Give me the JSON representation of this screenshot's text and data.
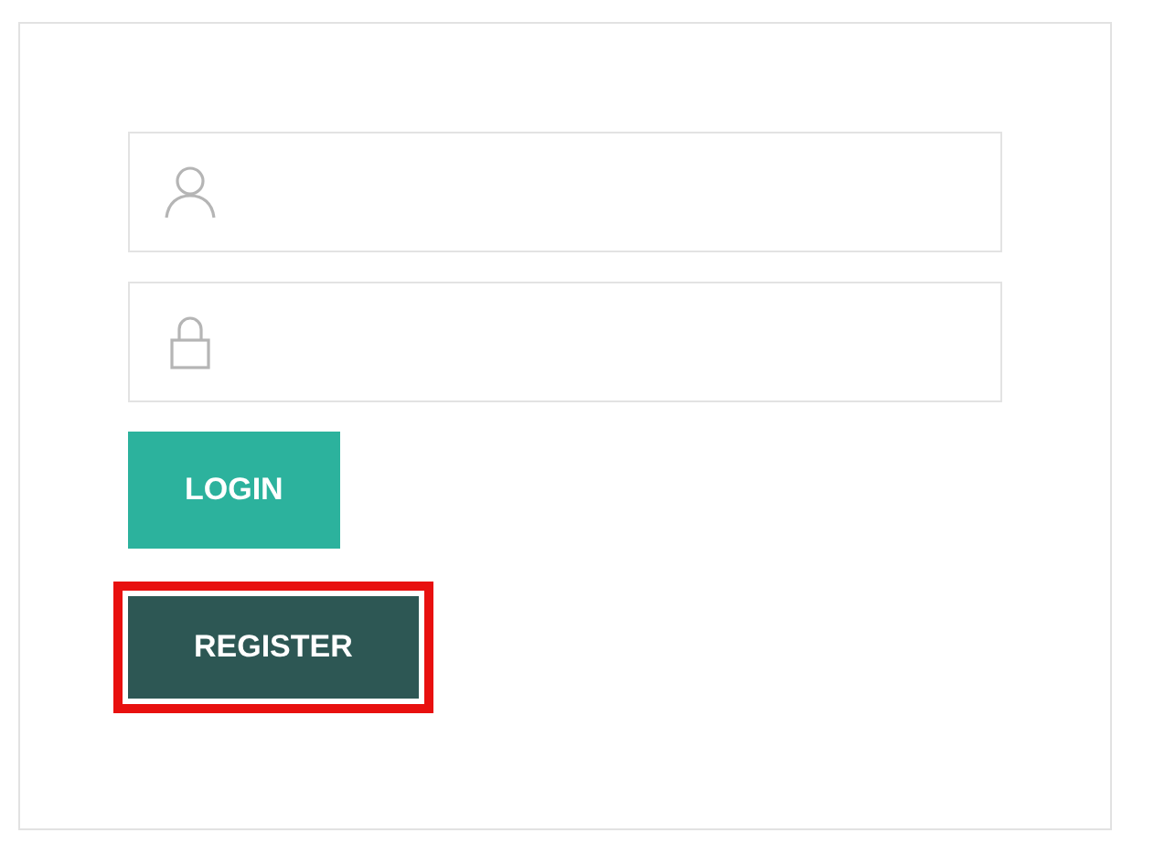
{
  "fields": [
    {
      "kind": "username"
    },
    {
      "kind": "password"
    }
  ],
  "buttons": [
    {
      "label": "LOGIN",
      "kind": "primary",
      "highlighted": false
    },
    {
      "label": "REGISTER",
      "kind": "secondary",
      "highlighted": true
    }
  ]
}
